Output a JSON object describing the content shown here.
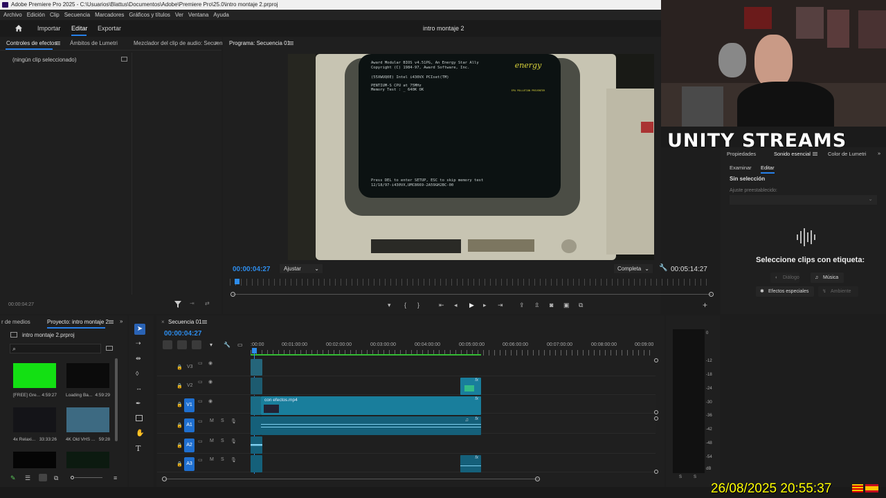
{
  "window_title": "Adobe Premiere Pro 2025 - C:\\Usuarios\\Blattus\\Documentos\\Adobe\\Premiere Pro\\25.0\\intro montaje 2.prproj",
  "menu": [
    "Archivo",
    "Edición",
    "Clip",
    "Secuencia",
    "Marcadores",
    "Gráficos y títulos",
    "Ver",
    "Ventana",
    "Ayuda"
  ],
  "workspace": {
    "import": "Importar",
    "edit": "Editar",
    "export": "Exportar",
    "project_title": "intro montaje 2"
  },
  "effects_panel": {
    "tab_effects": "Controles de efectos",
    "tab_lumetri": "Ámbitos de Lumetri",
    "tab_mixer": "Mezclador del clip de audio: Secuen",
    "no_clip": "(ningún clip seleccionado)",
    "timecode": "00:00:04:27"
  },
  "program": {
    "tab": "Programa: Secuencia 01",
    "timecode": "00:00:04:27",
    "fit": "Ajustar",
    "quality": "Completa",
    "duration": "00:05:14:27"
  },
  "bios": {
    "line1": "Award Modular BIOS v4.51PG, An Energy Star Ally",
    "line2": "Copyright (C) 1984-97, Award Software, Inc.",
    "line3": "(55XWUQ0E) Intel i430VX PCIset(TM)",
    "line4": "PENTIUM-S CPU at 75MHz",
    "line5": "Memory Test :  _  640K OK",
    "line6": "Press DEL to enter SETUP, ESC to skip memory test",
    "line7": "12/18/97-i430VX,UMC8669-2A59GH2BC-00",
    "logo": "energy",
    "logo_sub": "EPA POLLUTION PREVENTER"
  },
  "project_panel": {
    "tab_media": "r de medios",
    "tab_project": "Proyecto: intro montaje 2",
    "file": "intro montaje 2.prproj",
    "items": [
      {
        "name": "[FREE] Gre...",
        "dur": "4:59:27",
        "color": "#13e013"
      },
      {
        "name": "Loading Ba...",
        "dur": "4:59:29",
        "color": "#0b0b0b"
      },
      {
        "name": "4x Relaxi...",
        "dur": "33:33:26",
        "color": "#141418"
      },
      {
        "name": "4K Old VHS ...",
        "dur": "59:28",
        "color": "#3d6a82"
      },
      {
        "name": "",
        "dur": "",
        "color": "#050505"
      },
      {
        "name": "",
        "dur": "",
        "color": "#0c1a10"
      }
    ]
  },
  "timeline": {
    "tab": "Secuencia 01",
    "timecode": "00:00:04:27",
    "ruler": [
      ":00:00",
      "00:01:00:00",
      "00:02:00:00",
      "00:03:00:00",
      "00:04:00:00",
      "00:05:00:00",
      "00:06:00:00",
      "00:07:00:00",
      "00:08:00:00",
      "00:09:00"
    ],
    "tracks": [
      "V3",
      "V2",
      "V1",
      "A1",
      "A2",
      "A3"
    ],
    "src_tracks": [
      "V1",
      "A1"
    ],
    "m": "M",
    "s": "S",
    "clip_name": "con efectos.mp4",
    "fx": "fx"
  },
  "meters": [
    "0",
    "-12",
    "-18",
    "-24",
    "-30",
    "-36",
    "-42",
    "-48",
    "-54",
    "dB"
  ],
  "meter_ss": [
    "S",
    "S"
  ],
  "stream_overlay": {
    "title": "UNITY STREAMS",
    "datetime": "26/08/2025 20:55:37"
  },
  "essential_sound": {
    "tab_props": "Propiedades",
    "tab_sound": "Sonido esencial",
    "tab_color": "Color de Lumetri",
    "sub_browse": "Examinar",
    "sub_edit": "Editar",
    "no_selection": "Sin selección",
    "preset_label": "Ajuste preestablecido:",
    "select_label": "Seleccione clips con etiqueta:",
    "dialogue": "Diálogo",
    "music": "Música",
    "sfx": "Efectos especiales",
    "ambience": "Ambiente"
  }
}
